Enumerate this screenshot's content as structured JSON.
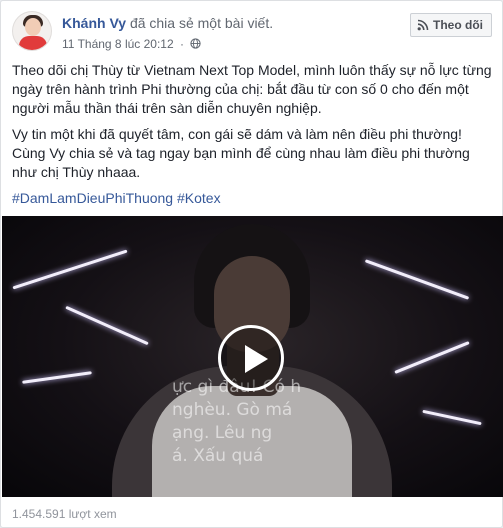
{
  "post": {
    "author": "Khánh Vy",
    "action": "đã chia sẻ một bài viết.",
    "timestamp": "11 Tháng 8 lúc 20:12",
    "separator": "·",
    "privacy_icon": "globe-icon",
    "follow_label": "Theo dõi",
    "follow_icon": "rss-icon"
  },
  "content": {
    "paragraph1": "Theo dõi chị Thùy từ Vietnam Next Top Model, mình luôn thấy sự nỗ lực từng ngày trên hành trình Phi thường của chị: bắt đầu từ con số 0 cho đến một người mẫu thần thái trên sàn diễn chuyên nghiệp.",
    "paragraph2": "Vy tin một khi đã quyết tâm, con gái sẽ dám và làm nên điều phi thường! Cùng Vy chia sẻ và tag ngay bạn mình để cùng nhau làm điều phi thường như chị Thùy nhaaa.",
    "hashtags": "#DamLamDieuPhiThuong #Kotex"
  },
  "video": {
    "overlay_text": "ực gì đâu! Có h\nnghèu. Gò má\nạng. Lêu ng\ná. Xấu quá",
    "play_icon": "play-icon"
  },
  "footer": {
    "views": "1.454.591 lượt xem"
  },
  "colors": {
    "link": "#365899",
    "text": "#1d2129",
    "meta": "#616770",
    "muted": "#90949c"
  }
}
